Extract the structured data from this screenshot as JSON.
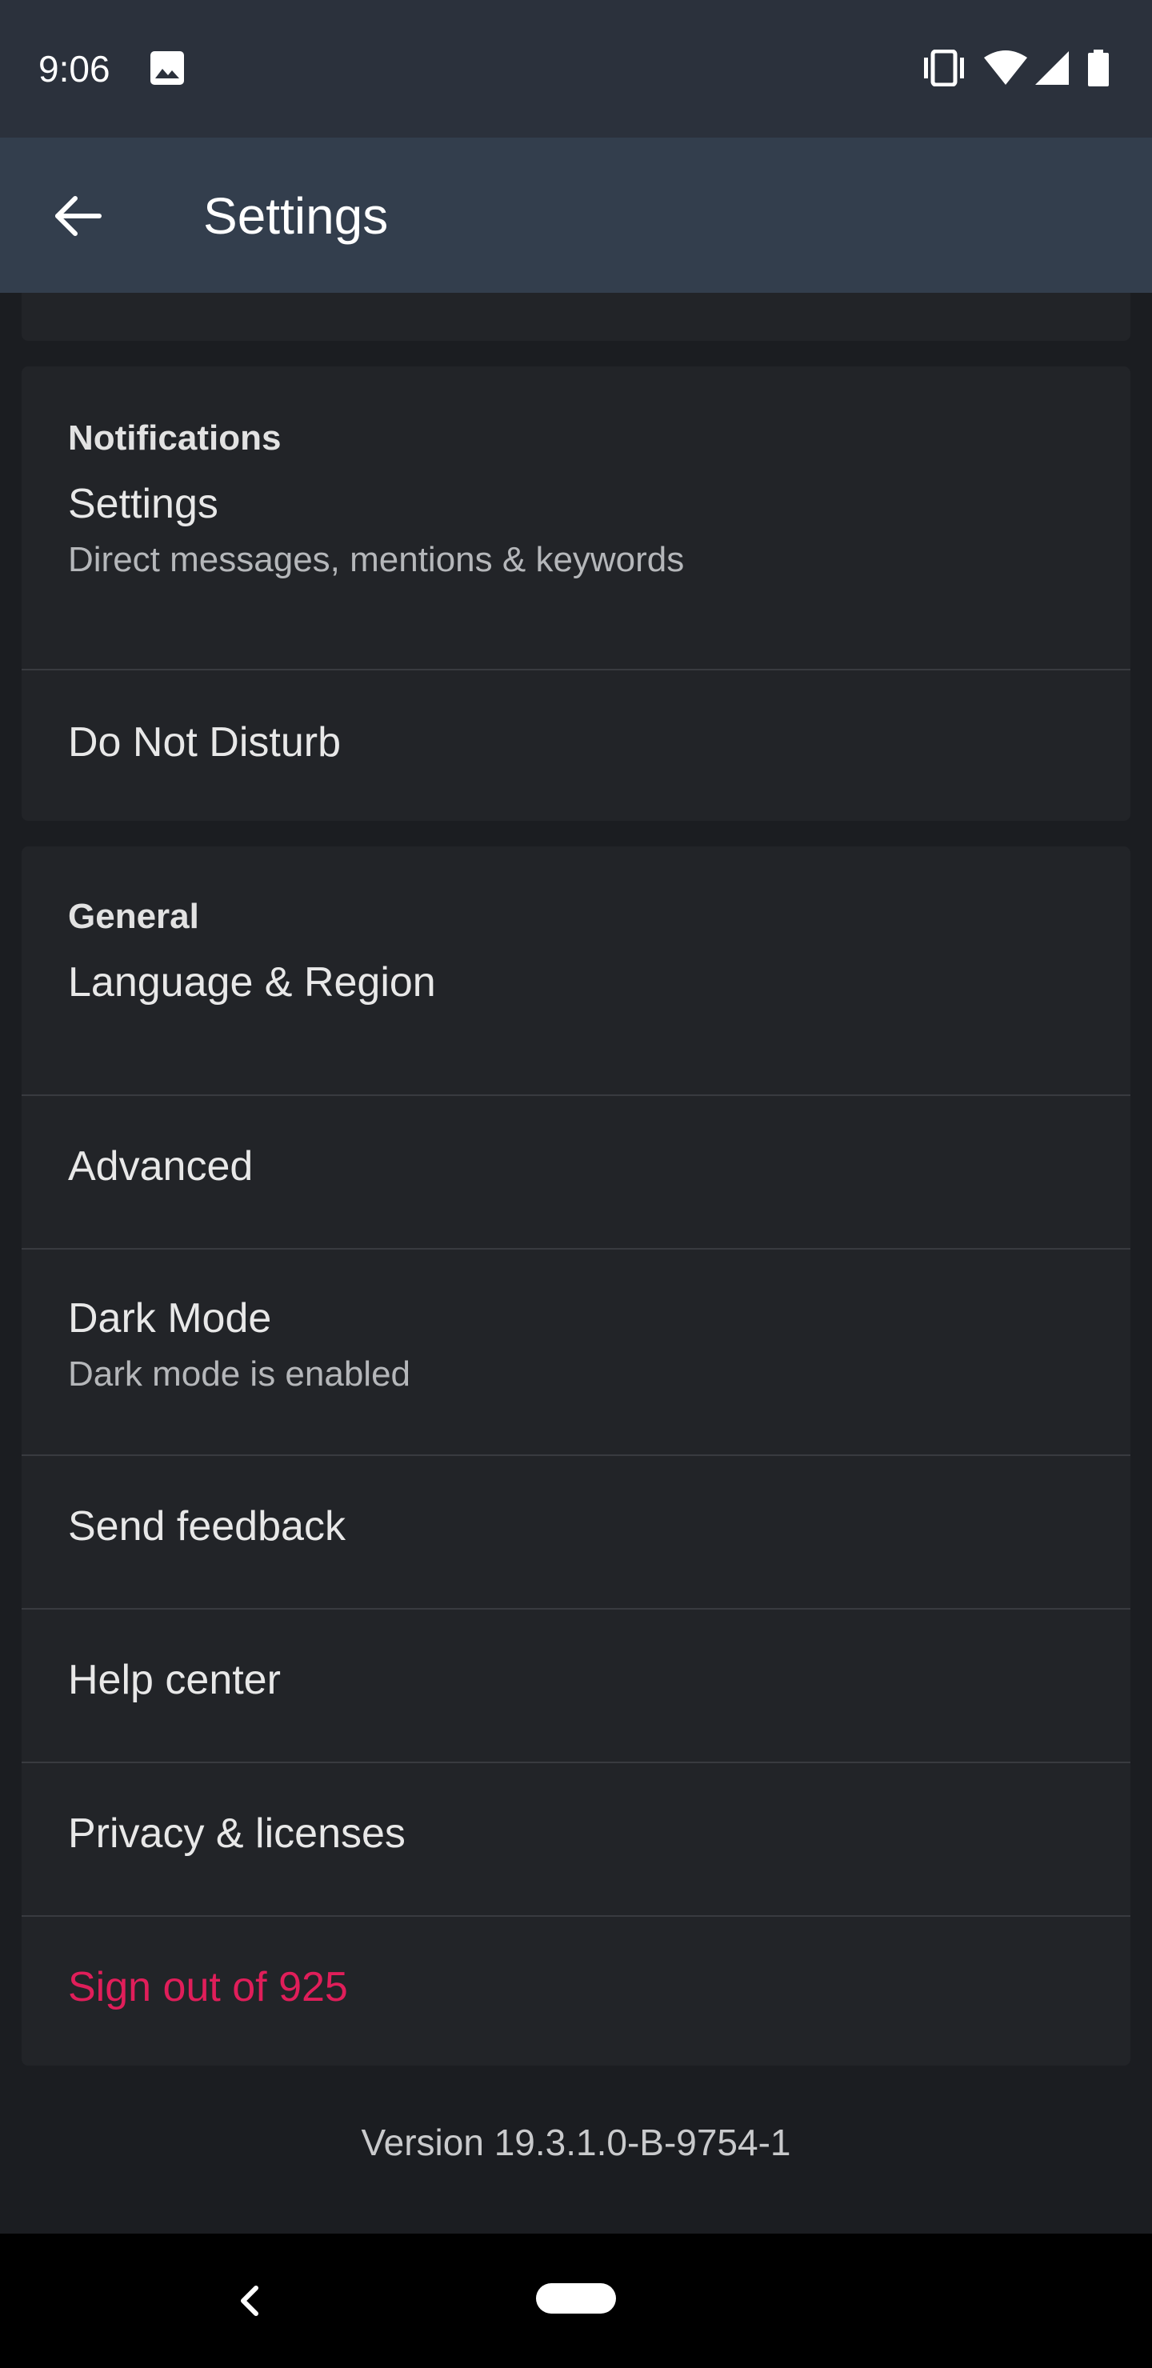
{
  "status_bar": {
    "time": "9:06",
    "icons": [
      "image-icon",
      "vibrate-icon",
      "wifi-icon",
      "signal-icon",
      "battery-icon"
    ]
  },
  "app_bar": {
    "title": "Settings",
    "back_icon": "arrow-left-icon"
  },
  "notifications": {
    "header": "Notifications",
    "settings_label": "Settings",
    "settings_sub": "Direct messages, mentions & keywords",
    "dnd_label": "Do Not Disturb"
  },
  "general": {
    "header": "General",
    "language_label": "Language & Region",
    "advanced_label": "Advanced",
    "dark_mode_label": "Dark Mode",
    "dark_mode_sub": "Dark mode is enabled",
    "feedback_label": "Send feedback",
    "help_label": "Help center",
    "privacy_label": "Privacy & licenses",
    "signout_label": "Sign out of 925"
  },
  "footer": {
    "version": "Version 19.3.1.0-B-9754-1"
  },
  "colors": {
    "background": "#1b1d21",
    "card": "#222428",
    "app_bar": "#333e4d",
    "status_bar": "#2b313c",
    "danger": "#e01e5a"
  },
  "nav_bar": {
    "icons": [
      "nav-back-icon",
      "nav-home-pill"
    ]
  }
}
